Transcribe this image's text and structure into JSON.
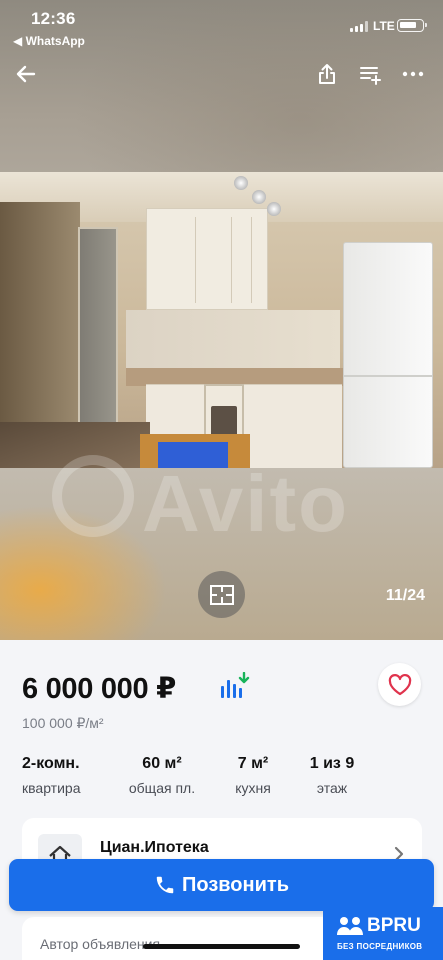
{
  "status_bar": {
    "time": "12:36",
    "back_app": "◀ WhatsApp",
    "network": "LTE"
  },
  "toolbar": {
    "back_icon": "arrow-left-icon",
    "share_icon": "share-icon",
    "add_to_list_icon": "playlist-add-icon",
    "more_icon": "more-horizontal-icon"
  },
  "gallery": {
    "watermark": "Avito",
    "counter": "11/24",
    "floorplan_icon": "floorplan-icon"
  },
  "listing": {
    "price": "6 000 000 ₽",
    "price_per_m2": "100 000 ₽/м²",
    "features": [
      {
        "value": "2-комн.",
        "label": "квартира"
      },
      {
        "value": "60 м²",
        "label": "общая пл."
      },
      {
        "value": "7 м²",
        "label": "кухня"
      },
      {
        "value": "1 из 9",
        "label": "этаж"
      }
    ]
  },
  "agency": {
    "name": "Циан.Ипотека"
  },
  "actions": {
    "call_label": "Позвонить"
  },
  "author": {
    "label": "Автор объявления"
  },
  "overlay_badge": {
    "title": "BPRU",
    "subtitle": "БЕЗ ПОСРЕДНИКОВ"
  },
  "colors": {
    "accent": "#1a6eea",
    "favorite": "#e0334d",
    "background": "#f4f5f8"
  }
}
